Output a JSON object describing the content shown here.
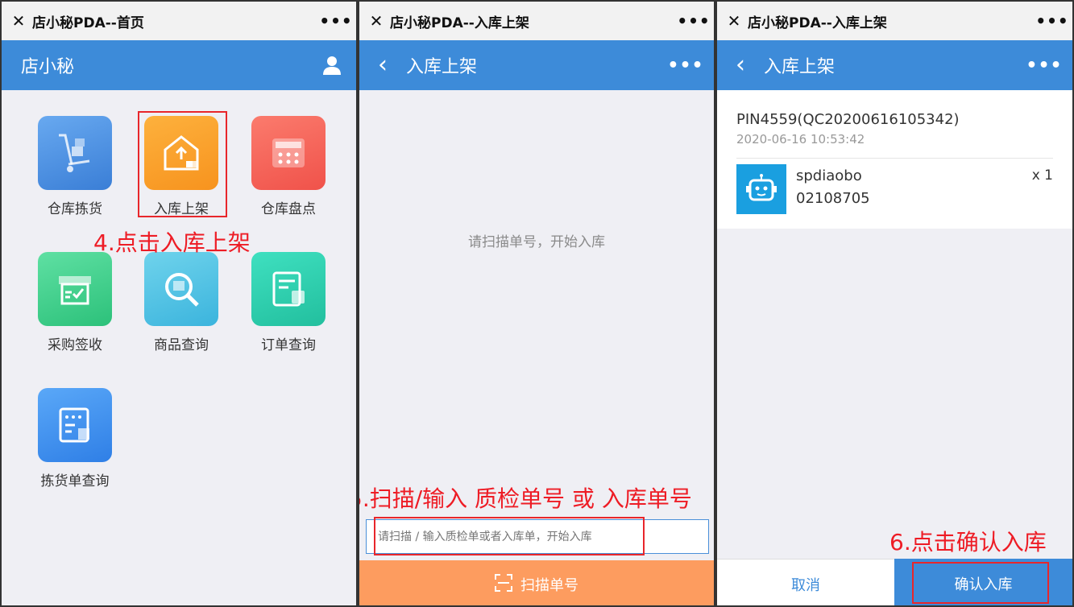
{
  "panel1": {
    "window_title": "店小秘PDA--首页",
    "close_glyph": "✕",
    "more_glyph": "•••",
    "app_title": "店小秘",
    "items": [
      {
        "label": "仓库拣货",
        "icon": "cart-icon",
        "color": "#4a90e2"
      },
      {
        "label": "入库上架",
        "icon": "warehouse-upload-icon",
        "color": "#f9a12c"
      },
      {
        "label": "仓库盘点",
        "icon": "calculator-icon",
        "color": "#f5645a"
      },
      {
        "label": "采购签收",
        "icon": "box-check-icon",
        "color": "#3ecf8e"
      },
      {
        "label": "商品查询",
        "icon": "magnifier-icon",
        "color": "#4cc0e0"
      },
      {
        "label": "订单查询",
        "icon": "document-bag-icon",
        "color": "#2cc7a8"
      },
      {
        "label": "拣货单查询",
        "icon": "list-board-icon",
        "color": "#3a8ff0"
      }
    ],
    "annotation": "4.点击入库上架"
  },
  "panel2": {
    "window_title": "店小秘PDA--入库上架",
    "close_glyph": "✕",
    "more_glyph": "•••",
    "back_glyph": "‹",
    "app_title": "入库上架",
    "empty_hint": "请扫描单号，开始入库",
    "annotation": "5.扫描/输入 质检单号 或 入库单号",
    "input_placeholder": "请扫描 / 输入质检单或者入库单，开始入库",
    "scan_button": "扫描单号"
  },
  "panel3": {
    "window_title": "店小秘PDA--入库上架",
    "close_glyph": "✕",
    "more_glyph": "•••",
    "back_glyph": "‹",
    "app_title": "入库上架",
    "order_no": "PIN4559(QC20200616105342)",
    "order_time": "2020-06-16 10:53:42",
    "product_name": "spdiaobo",
    "product_code": "02108705",
    "quantity": "x 1",
    "annotation": "6.点击确认入库",
    "cancel_label": "取消",
    "confirm_label": "确认入库"
  },
  "colors": {
    "app_bar": "#3d8bd9",
    "scan_button": "#fd9c5f",
    "annotation": "#ee1c25"
  }
}
